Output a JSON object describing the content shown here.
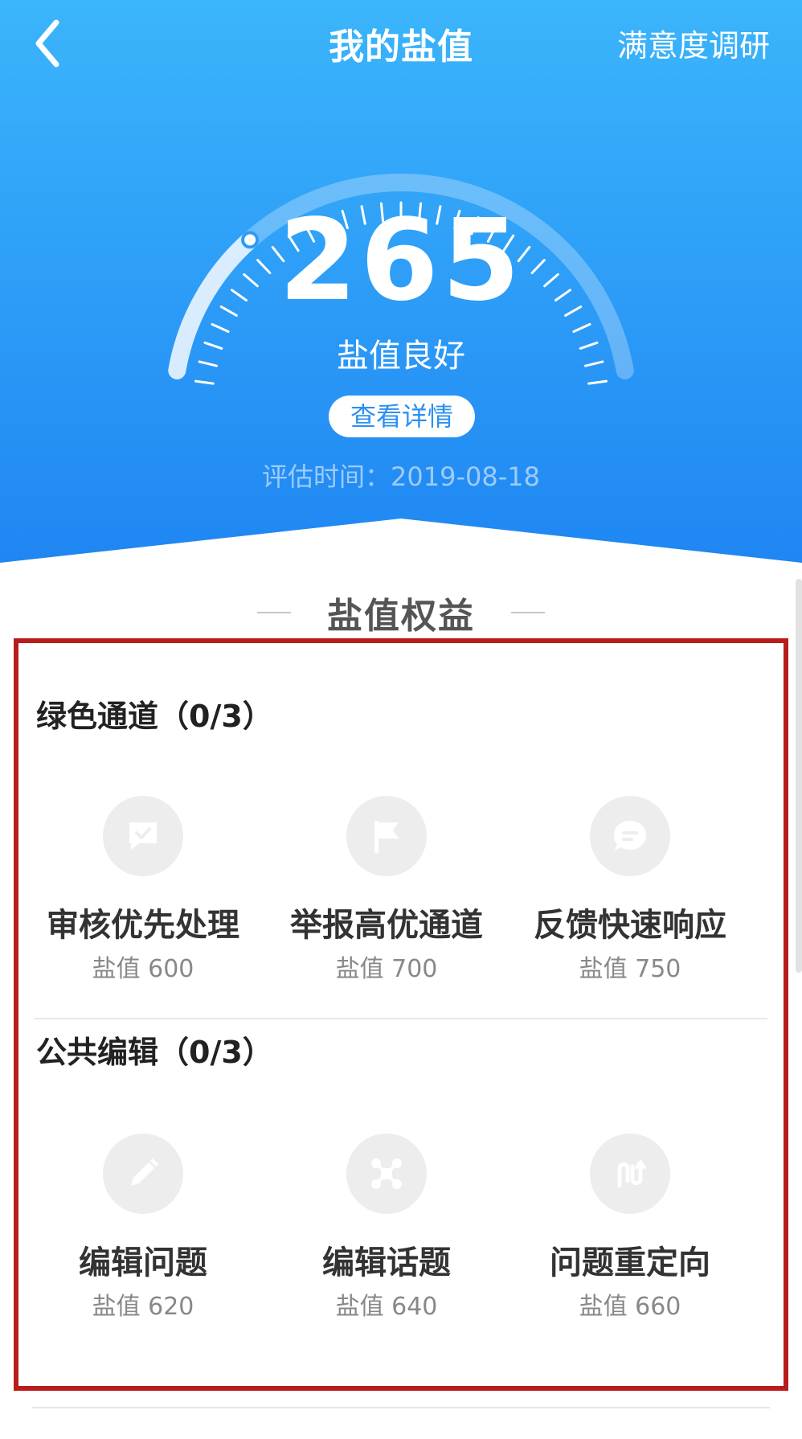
{
  "nav": {
    "title": "我的盐值",
    "survey_label": "满意度调研"
  },
  "gauge": {
    "score": "265",
    "level": "盐值良好",
    "detail_label": "查看详情",
    "eval_date": "评估时间：2019-08-18",
    "progress_fraction": 0.24
  },
  "benefits": {
    "title": "盐值权益",
    "groups": [
      {
        "title": "绿色通道（0/3）",
        "items": [
          {
            "name": "审核优先处理",
            "req": "盐值 600",
            "icon": "check-message-icon"
          },
          {
            "name": "举报高优通道",
            "req": "盐值 700",
            "icon": "flag-icon"
          },
          {
            "name": "反馈快速响应",
            "req": "盐值 750",
            "icon": "chat-bubble-icon"
          }
        ]
      },
      {
        "title": "公共编辑（0/3）",
        "items": [
          {
            "name": "编辑问题",
            "req": "盐值 620",
            "icon": "pencil-icon"
          },
          {
            "name": "编辑话题",
            "req": "盐值 640",
            "icon": "nodes-icon"
          },
          {
            "name": "问题重定向",
            "req": "盐值 660",
            "icon": "redirect-arrows-icon"
          }
        ]
      }
    ]
  },
  "colors": {
    "header_top": "#3bb5fb",
    "header_bottom": "#1f86f2",
    "highlight_border": "#b81c1c",
    "icon_bg": "#ededed",
    "icon_glyph": "#ffffff"
  }
}
